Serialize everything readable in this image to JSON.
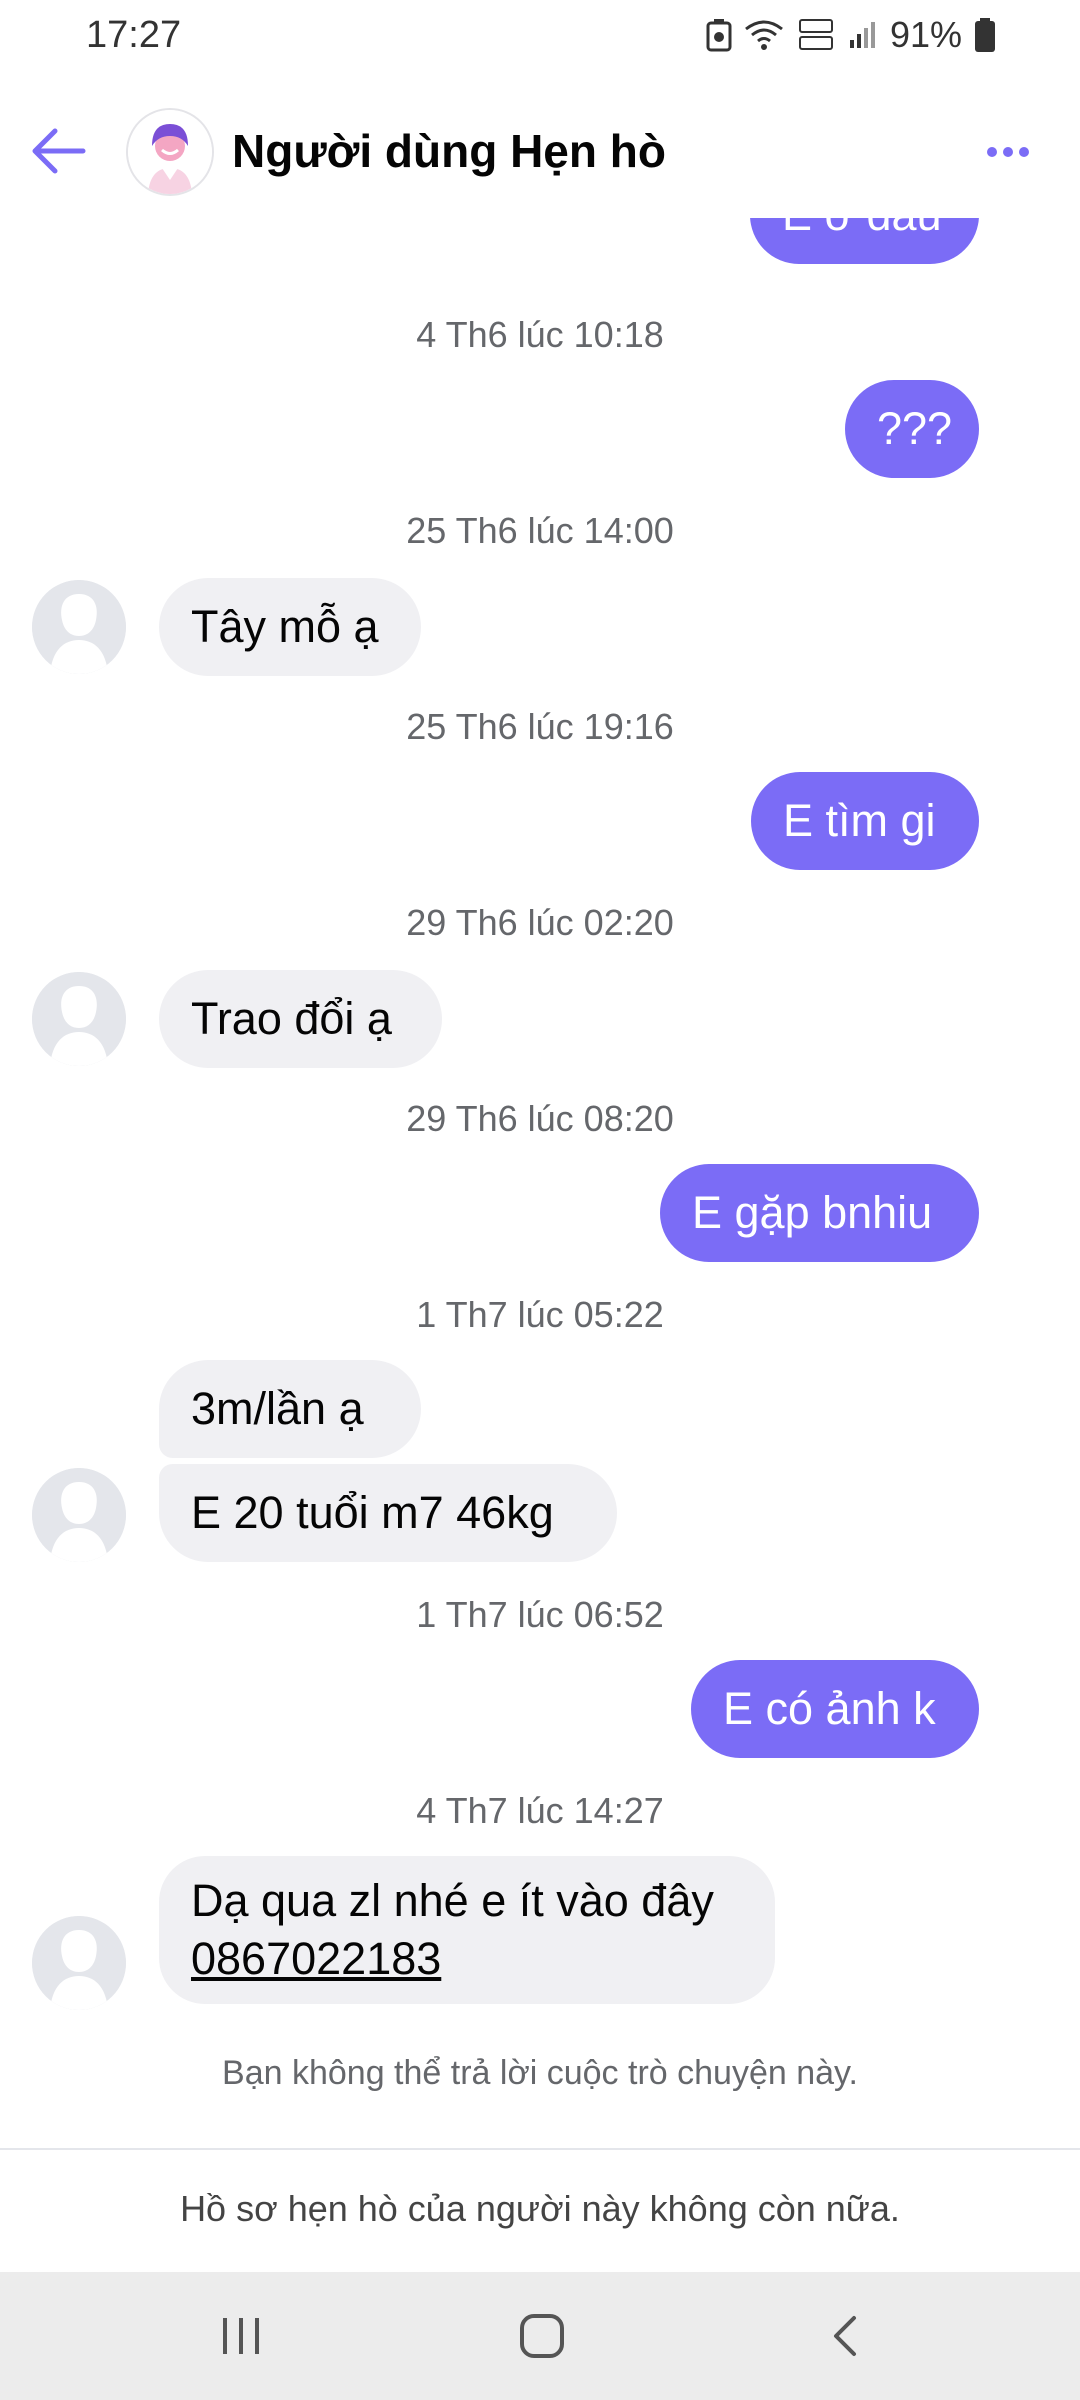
{
  "status_bar": {
    "time": "17:27",
    "battery": "91%"
  },
  "header": {
    "title": "Người dùng Hẹn hò"
  },
  "messages": {
    "partial_out": "E ở đâu",
    "ts1": "4 Th6 lúc 10:18",
    "out1": "???",
    "ts2": "25 Th6 lúc 14:00",
    "in1": "Tây mỗ ạ",
    "ts3": "25 Th6 lúc 19:16",
    "out2": "E tìm gi",
    "ts4": "29 Th6 lúc 02:20",
    "in2": "Trao đổi ạ",
    "ts5": "29 Th6 lúc 08:20",
    "out3": "E gặp bnhiu",
    "ts6": "1 Th7 lúc 05:22",
    "in3": "3m/lần ạ",
    "in4": "E 20 tuổi m7 46kg",
    "ts7": "1 Th7 lúc 06:52",
    "out4": "E có ảnh k",
    "ts8": "4 Th7 lúc 14:27",
    "in5_line1": "Dạ qua zl nhé e ít vào đây",
    "in5_phone": "0867022183",
    "cannot_reply": "Bạn không thể trả lời cuộc trò chuyện này."
  },
  "footer": {
    "notice": "Hồ sơ hẹn hò của người này không còn nữa."
  },
  "icons": {
    "back": "back-arrow-icon",
    "more": "more-dots-icon",
    "nav_recents": "recents-icon",
    "nav_home": "home-icon",
    "nav_back": "nav-back-icon"
  },
  "colors": {
    "accent": "#7b6cf6",
    "incoming_bubble": "#f0f0f3"
  }
}
